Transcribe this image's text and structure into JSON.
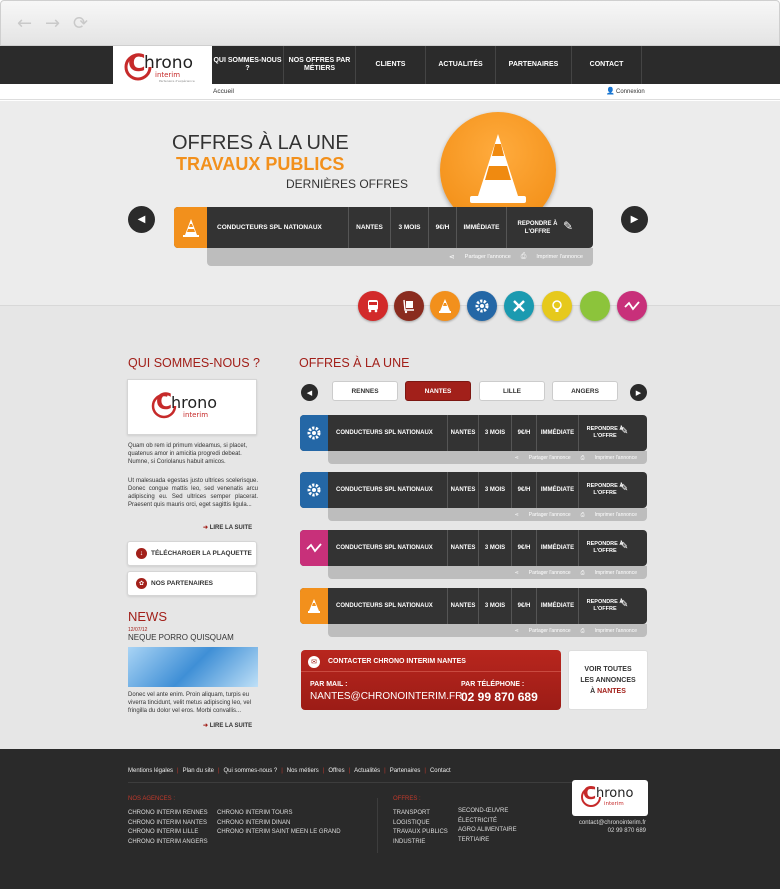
{
  "browser": {
    "back": "←",
    "forward": "→",
    "reload": "⟳"
  },
  "logo": {
    "main": "hrono",
    "c": "C",
    "sub": "interim",
    "tagline": "Partenaire d'expérience"
  },
  "menu": [
    {
      "label": "QUI SOMMES-NOUS ?",
      "w": 72
    },
    {
      "label": "NOS OFFRES PAR MÉTIERS",
      "w": 72
    },
    {
      "label": "CLIENTS",
      "w": 70
    },
    {
      "label": "ACTUALITÉS",
      "w": 70
    },
    {
      "label": "PARTENAIRES",
      "w": 76
    },
    {
      "label": "CONTACT",
      "w": 70
    }
  ],
  "breadcrumb": "Accueil",
  "login": "Connexion",
  "hero": {
    "line1": "OFFRES À LA UNE",
    "line2": "TRAVAUX PUBLICS",
    "line3": "DERNIÈRES OFFRES",
    "job": {
      "title": "CONDUCTEURS SPL NATIONAUX",
      "city": "NANTES",
      "duration": "3 MOIS",
      "rate": "9€/H",
      "start": "IMMÉDIATE",
      "reply": "REPONDRE À L'OFFRE"
    },
    "share": "Partager l'annonce",
    "print": "Imprimer l'annonce"
  },
  "categories": [
    {
      "icon": "bus-icon",
      "color": "#d22a2a"
    },
    {
      "icon": "trolley-icon",
      "color": "#8a2c1f"
    },
    {
      "icon": "cone-icon",
      "color": "#f2901c"
    },
    {
      "icon": "gear-icon",
      "color": "#2467a6"
    },
    {
      "icon": "tools-icon",
      "color": "#1b9ab0"
    },
    {
      "icon": "bulb-icon",
      "color": "#e6c91c"
    },
    {
      "icon": "leaf-icon",
      "color": "#8cc43b"
    },
    {
      "icon": "chart-icon",
      "color": "#c8307a"
    }
  ],
  "about": {
    "title": "QUI SOMMES-NOUS ?",
    "p1": "Quam ob rem id primum videamus, si placet, quatenus amor in amicitia progredi debeat. Numne, si Coriolanus habuit amicos.",
    "p2": "Ut malesuada egestas justo ultrices scelerisque. Donec congue mattis leo, sed venenatis arcu adipiscing eu. Sed ultrices semper placerat. Praesent quis mauris orci, eget sagittis ligula...",
    "more": "LIRE LA SUITE",
    "download": "TÉLÉCHARGER LA PLAQUETTE",
    "partners": "NOS PARTENAIRES"
  },
  "news": {
    "title": "NEWS",
    "date": "12/07/12",
    "headline": "NEQUE PORRO QUISQUAM",
    "text": "Donec vel ante enim. Proin aliquam, turpis eu viverra tincidunt, velit metus adipiscing leo, vel fringilla du dolor vel eros. Morbi convallis...",
    "more": "LIRE LA SUITE"
  },
  "offers": {
    "title": "OFFRES À LA UNE",
    "cities": [
      "RENNES",
      "NANTES",
      "LILLE",
      "ANGERS"
    ],
    "active": "NANTES",
    "list": [
      {
        "icon": "gear-icon",
        "color": "#2467a6",
        "title": "CONDUCTEURS SPL NATIONAUX",
        "city": "NANTES",
        "duration": "3 MOIS",
        "rate": "9€/H",
        "start": "IMMÉDIATE",
        "reply": "REPONDRE À L'OFFRE"
      },
      {
        "icon": "gear-icon",
        "color": "#2467a6",
        "title": "CONDUCTEURS SPL NATIONAUX",
        "city": "NANTES",
        "duration": "3 MOIS",
        "rate": "9€/H",
        "start": "IMMÉDIATE",
        "reply": "REPONDRE À L'OFFRE"
      },
      {
        "icon": "chart-icon",
        "color": "#c8307a",
        "title": "CONDUCTEURS SPL NATIONAUX",
        "city": "NANTES",
        "duration": "3 MOIS",
        "rate": "9€/H",
        "start": "IMMÉDIATE",
        "reply": "REPONDRE À L'OFFRE"
      },
      {
        "icon": "cone-icon",
        "color": "#f2901c",
        "title": "CONDUCTEURS SPL NATIONAUX",
        "city": "NANTES",
        "duration": "3 MOIS",
        "rate": "9€/H",
        "start": "IMMÉDIATE",
        "reply": "REPONDRE À L'OFFRE"
      }
    ],
    "share": "Partager l'annonce",
    "print": "Imprimer l'annonce"
  },
  "contact": {
    "title": "CONTACTER CHRONO INTERIM NANTES",
    "mail_label": "PAR MAIL :",
    "mail": "NANTES@CHRONOINTERIM.FR",
    "phone_label": "PAR TÉLÉPHONE :",
    "phone": "02 99 870 689"
  },
  "seeAll": {
    "line1": "VOIR TOUTES",
    "line2": "LES ANNONCES",
    "prefix": "À",
    "city": "NANTES"
  },
  "footer": {
    "links": [
      "Mentions légales",
      "Plan du site",
      "Qui sommes-nous ?",
      "Nos métiers",
      "Offres",
      "Actualités",
      "Partenaires",
      "Contact"
    ],
    "agencies_title": "NOS AGENCES :",
    "agencies_col1": [
      "CHRONO INTERIM RENNES",
      "CHRONO INTERIM NANTES",
      "CHRONO INTERIM LILLE",
      "CHRONO INTERIM ANGERS"
    ],
    "agencies_col2": [
      "CHRONO INTERIM TOURS",
      "CHRONO INTERIM DINAN",
      "CHRONO INTERIM SAINT MEEN LE GRAND"
    ],
    "offers_title": "OFFRES :",
    "offers_col1": [
      "TRANSPORT",
      "LOGISTIQUE",
      "TRAVAUX PUBLICS",
      "INDUSTRIE"
    ],
    "offers_col2": [
      "SECOND-ŒUVRE",
      "ÉLECTRICITÉ",
      "AGRO ALIMENTAIRE",
      "TERTIAIRE"
    ],
    "email": "contact@chronointerim.fr",
    "phone": "02 99 870 689"
  }
}
